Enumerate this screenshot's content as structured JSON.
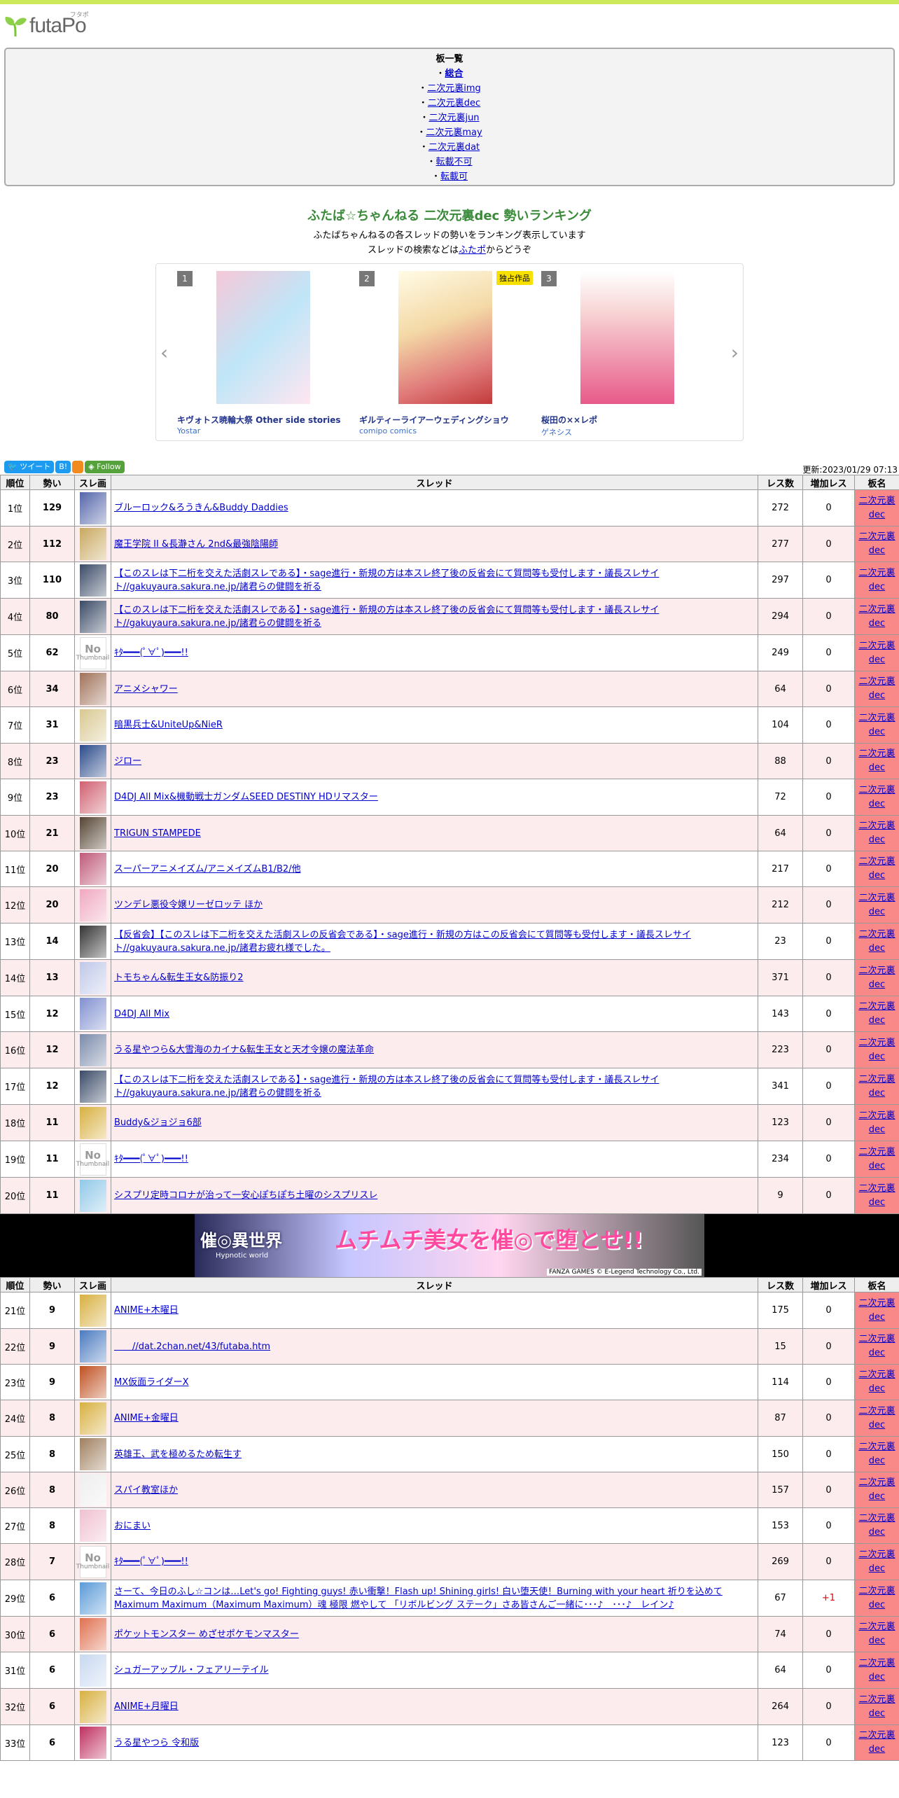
{
  "logo": {
    "text": "futaPo",
    "ruby": "フタポ"
  },
  "boards": {
    "heading": "板一覧",
    "items": [
      "総合",
      "二次元裏img",
      "二次元裏dec",
      "二次元裏jun",
      "二次元裏may",
      "二次元裏dat",
      "転載不可",
      "転載可",
      "..."
    ]
  },
  "page_title": "ふたば☆ちゃんねる 二次元裏dec 勢いランキング",
  "desc": {
    "line1": "ふたばちゃんねるの各スレッドの勢いをランキング表示しています",
    "line2_pre": "スレッドの検索などは",
    "line2_link": "ふたポ",
    "line2_post": "からどうぞ"
  },
  "carousel": [
    {
      "num": "1",
      "title": "キヴォトス暁輪大祭 Other side stories",
      "pub": "Yostar",
      "badge": ""
    },
    {
      "num": "2",
      "title": "ギルティーライアーウェディングショウ",
      "pub": "comipo comics",
      "badge": "独占作品"
    },
    {
      "num": "3",
      "title": "桜田の××レポ",
      "pub": "ゲネシス",
      "badge": ""
    }
  ],
  "social": {
    "tweet": "ツイート",
    "hatena": "B!",
    "follow": "Follow"
  },
  "updated": "更新:2023/01/29 07:13",
  "headers": [
    "順位",
    "勢い",
    "スレ画",
    "スレッド",
    "レス数",
    "増加レス",
    "板名"
  ],
  "board_name": "二次元裏dec",
  "ad": {
    "logo": "催◎異世界",
    "sub": "Hypnotic world",
    "main": "ムチムチ美女を催◎で堕とせ!!",
    "copy": "FANZA GAMES © E-Legend Technology Co., Ltd."
  },
  "rows1": [
    {
      "rank": "1位",
      "mom": "129",
      "title": "ブルーロック&ろうきん&Buddy Daddies",
      "res": "272",
      "inc": "0",
      "thumb": "#5566aa"
    },
    {
      "rank": "2位",
      "mom": "112",
      "title": "魔王学院 II &長瀞さん 2nd&最強陰陽師",
      "res": "277",
      "inc": "0",
      "thumb": "#c9a860"
    },
    {
      "rank": "3位",
      "mom": "110",
      "title": "【このスレは下二桁を交えた活劇スレである】・sage進行・新規の方は本スレ終了後の反省会にて質問等も受付します・議長スレサイト//gakuyaura.sakura.ne.jp/諸君らの健闘を祈る",
      "res": "297",
      "inc": "0",
      "thumb": "#3a4a66"
    },
    {
      "rank": "4位",
      "mom": "80",
      "title": "【このスレは下二桁を交えた活劇スレである】・sage進行・新規の方は本スレ終了後の反省会にて質問等も受付します・議長スレサイト//gakuyaura.sakura.ne.jp/諸君らの健闘を祈る",
      "res": "294",
      "inc": "0",
      "thumb": "#3a4a66"
    },
    {
      "rank": "5位",
      "mom": "62",
      "title": "ｷﾀ━━━(ﾟ∀ﾟ)━━━!!",
      "res": "249",
      "inc": "0",
      "thumb": "none"
    },
    {
      "rank": "6位",
      "mom": "34",
      "title": "アニメシャワー",
      "res": "64",
      "inc": "0",
      "thumb": "#a0725a"
    },
    {
      "rank": "7位",
      "mom": "31",
      "title": "暗黒兵士&UniteUp&NieR",
      "res": "104",
      "inc": "0",
      "thumb": "#d8c890"
    },
    {
      "rank": "8位",
      "mom": "23",
      "title": "ジロー",
      "res": "88",
      "inc": "0",
      "thumb": "#2a4a8a"
    },
    {
      "rank": "9位",
      "mom": "23",
      "title": "D4DJ All Mix&機動戦士ガンダムSEED DESTINY HDリマスター",
      "res": "72",
      "inc": "0",
      "thumb": "#d06070"
    },
    {
      "rank": "10位",
      "mom": "21",
      "title": "TRIGUN STAMPEDE",
      "res": "64",
      "inc": "0",
      "thumb": "#554433"
    },
    {
      "rank": "11位",
      "mom": "20",
      "title": "スーパーアニメイズム/アニメイズムB1/B2/他",
      "res": "217",
      "inc": "0",
      "thumb": "#c05a7a"
    },
    {
      "rank": "12位",
      "mom": "20",
      "title": "ツンデレ悪役令嬢リーゼロッテ ほか",
      "res": "212",
      "inc": "0",
      "thumb": "#f0a8c0"
    },
    {
      "rank": "13位",
      "mom": "14",
      "title": "【反省会】【このスレは下二桁を交えた活劇スレの反省会である】・sage進行・新規の方はこの反省会にて質問等も受付します・議長スレサイト//gakuyaura.sakura.ne.jp/諸君お疲れ様でした。",
      "res": "23",
      "inc": "0",
      "thumb": "#333333"
    },
    {
      "rank": "14位",
      "mom": "13",
      "title": "トモちゃん&転生王女&防振り2",
      "res": "371",
      "inc": "0",
      "thumb": "#c0c8e8"
    },
    {
      "rank": "15位",
      "mom": "12",
      "title": "D4DJ All Mix",
      "res": "143",
      "inc": "0",
      "thumb": "#8090d0"
    },
    {
      "rank": "16位",
      "mom": "12",
      "title": "うる星やつら&大雪海のカイナ&転生王女と天才令嬢の魔法革命",
      "res": "223",
      "inc": "0",
      "thumb": "#7a8aaa"
    },
    {
      "rank": "17位",
      "mom": "12",
      "title": "【このスレは下二桁を交えた活劇スレである】・sage進行・新規の方は本スレ終了後の反省会にて質問等も受付します・議長スレサイト//gakuyaura.sakura.ne.jp/諸君らの健闘を祈る",
      "res": "341",
      "inc": "0",
      "thumb": "#3a4a66"
    },
    {
      "rank": "18位",
      "mom": "11",
      "title": "Buddy&ジョジョ6部",
      "res": "123",
      "inc": "0",
      "thumb": "#d8b040"
    },
    {
      "rank": "19位",
      "mom": "11",
      "title": "ｷﾀ━━━(ﾟ∀ﾟ)━━━!!",
      "res": "234",
      "inc": "0",
      "thumb": "none"
    },
    {
      "rank": "20位",
      "mom": "11",
      "title": "シスプリ定時コロナが治って一安心ぽちぽち土曜のシスプリスレ",
      "res": "9",
      "inc": "0",
      "thumb": "#90c8e8"
    }
  ],
  "rows2": [
    {
      "rank": "21位",
      "mom": "9",
      "title": "ANIME+木曜日",
      "res": "175",
      "inc": "0",
      "thumb": "#d8b040"
    },
    {
      "rank": "22位",
      "mom": "9",
      "title": "　　//dat.2chan.net/43/futaba.htm",
      "res": "15",
      "inc": "0",
      "thumb": "#4a7ac0"
    },
    {
      "rank": "23位",
      "mom": "9",
      "title": "MX仮面ライダーX",
      "res": "114",
      "inc": "0",
      "thumb": "#c05020"
    },
    {
      "rank": "24位",
      "mom": "8",
      "title": "ANIME+金曜日",
      "res": "87",
      "inc": "0",
      "thumb": "#d8b040"
    },
    {
      "rank": "25位",
      "mom": "8",
      "title": "英雄王、武を極めるため転生す",
      "res": "150",
      "inc": "0",
      "thumb": "#a08060"
    },
    {
      "rank": "26位",
      "mom": "8",
      "title": "スパイ教室ほか",
      "res": "157",
      "inc": "0",
      "thumb": "#eeeeee"
    },
    {
      "rank": "27位",
      "mom": "8",
      "title": "おにまい",
      "res": "153",
      "inc": "0",
      "thumb": "#f0c0d0"
    },
    {
      "rank": "28位",
      "mom": "7",
      "title": "ｷﾀ━━━(ﾟ∀ﾟ)━━━!!",
      "res": "269",
      "inc": "0",
      "thumb": "none"
    },
    {
      "rank": "29位",
      "mom": "6",
      "title": "さーて、今日のふし☆コンは…Let's go! Fighting guys! 赤い衝撃！Flash up! Shining girls! 白い堕天使！Burning with your heart 祈りを込めて Maximum Maximum（Maximum Maximum）魂 極限 燃やして 「リボルビング ステーク」さあ皆さんご一緒に･･･♪　･･･♪　レイン♪",
      "res": "67",
      "inc": "+1",
      "thumb": "#5a9ad8"
    },
    {
      "rank": "30位",
      "mom": "6",
      "title": "ポケットモンスター めざせポケモンマスター",
      "res": "74",
      "inc": "0",
      "thumb": "#e07050"
    },
    {
      "rank": "31位",
      "mom": "6",
      "title": "シュガーアップル・フェアリーテイル",
      "res": "64",
      "inc": "0",
      "thumb": "#c8d8f0"
    },
    {
      "rank": "32位",
      "mom": "6",
      "title": "ANIME+月曜日",
      "res": "264",
      "inc": "0",
      "thumb": "#d8b040"
    },
    {
      "rank": "33位",
      "mom": "6",
      "title": "うる星やつら 令和版",
      "res": "123",
      "inc": "0",
      "thumb": "#c03060"
    }
  ]
}
